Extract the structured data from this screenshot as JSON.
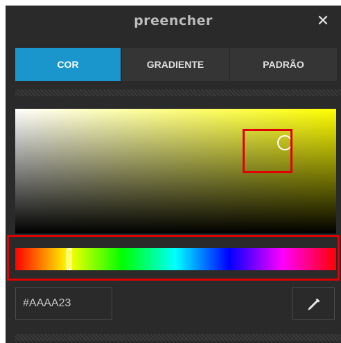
{
  "dialog": {
    "title": "preencher",
    "close_icon": "close-icon"
  },
  "tabs": [
    {
      "label": "COR",
      "active": true
    },
    {
      "label": "GRADIENTE",
      "active": false
    },
    {
      "label": "PADRÃO",
      "active": false
    }
  ],
  "color_picker": {
    "hue_color": "#ffff00",
    "saturation_brightness_handle": {
      "saturation": 0.84,
      "brightness": 0.73
    },
    "hue_handle": {
      "hue_degrees": 61
    },
    "highlight_color": "#e00000"
  },
  "hex_input": {
    "value": "#AAAA23"
  },
  "eyedropper": {
    "icon": "eyedropper-icon"
  }
}
